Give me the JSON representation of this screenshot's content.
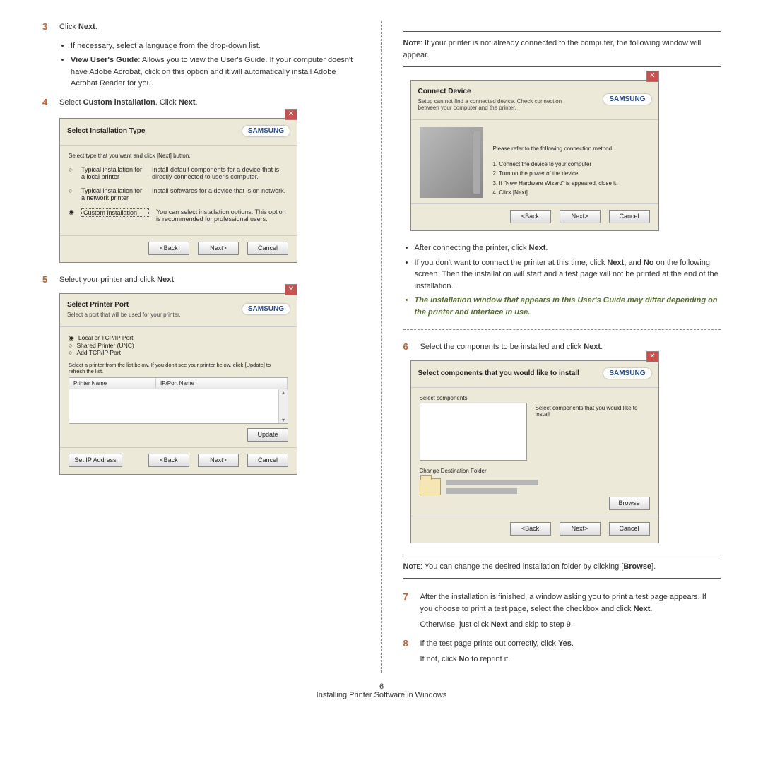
{
  "page_number": "6",
  "footer": "Installing Printer Software in Windows",
  "brand": "SAMSUNG",
  "left": {
    "step3": {
      "num": "3",
      "text_prefix": "Click ",
      "text_bold": "Next",
      "text_suffix": ".",
      "b1": "If necessary, select a language from the drop-down list.",
      "b2_bold": "View User's Guide",
      "b2_rest": ": Allows you to view the User's Guide. If your computer doesn't have Adobe Acrobat, click on this option and it will automatically install Adobe Acrobat Reader for you."
    },
    "step4": {
      "num": "4",
      "t1": "Select ",
      "t2": "Custom installation",
      "t3": ". Click ",
      "t4": "Next",
      "t5": "."
    },
    "dlg1": {
      "title": "Select Installation Type",
      "intro": "Select type that you want and click [Next] button.",
      "opt1_lbl": "Typical installation for a local printer",
      "opt1_desc": "Install default components for a device that is directly connected to user's computer.",
      "opt2_lbl": "Typical installation for a network printer",
      "opt2_desc": "Install softwares for a device that is on network.",
      "opt3_lbl": "Custom installation",
      "opt3_desc": "You can select installation options. This option is recommended for professional users.",
      "back": "<Back",
      "next": "Next>",
      "cancel": "Cancel"
    },
    "step5": {
      "num": "5",
      "t1": "Select your printer and click ",
      "t2": "Next",
      "t3": "."
    },
    "dlg2": {
      "title": "Select Printer Port",
      "sub": "Select a port that will be used for your printer.",
      "r1": "Local or TCP/IP Port",
      "r2": "Shared Printer (UNC)",
      "r3": "Add TCP/IP Port",
      "hint": "Select a printer from the list below. If you don't see your printer below, click [Update] to refresh the list.",
      "col1": "Printer Name",
      "col2": "IP/Port Name",
      "update": "Update",
      "setip": "Set IP Address",
      "back": "<Back",
      "next": "Next>",
      "cancel": "Cancel"
    }
  },
  "right": {
    "note1_lbl": "Note",
    "note1_rest": ": If your printer is not already connected to the computer, the following window will appear.",
    "dlg_conn": {
      "title": "Connect Device",
      "sub": "Setup can not find a connected device. Check connection between your computer and the printer.",
      "intro": "Please refer to the following connection method.",
      "l1": "1. Connect the device to your computer",
      "l2": "2. Turn on the power of the device",
      "l3": "3. If \"New Hardware Wizard\" is appeared, close it.",
      "l4": "4. Click [Next]",
      "back": "<Back",
      "next": "Next>",
      "cancel": "Cancel"
    },
    "bul_after1_a": "After connecting the printer, click ",
    "bul_after1_b": "Next",
    "bul_after1_c": ".",
    "bul_after2_a": "If you don't want to connect the printer at this time, click ",
    "bul_after2_b": "Next",
    "bul_after2_c": ", and ",
    "bul_after2_d": "No",
    "bul_after2_e": " on the following screen. Then the installation will start and a test page will not be printed at the end of the installation.",
    "bul_after3": "The installation window that appears in this User's Guide may differ depending on the printer and interface in use.",
    "step6": {
      "num": "6",
      "t1": "Select the components to be installed and click ",
      "t2": "Next",
      "t3": "."
    },
    "dlg_comp": {
      "title": "Select components that you would like to install",
      "sel": "Select components",
      "side": "Select components that you would like to install",
      "chg": "Change Destination Folder",
      "browse": "Browse",
      "back": "<Back",
      "next": "Next>",
      "cancel": "Cancel"
    },
    "note2_lbl": "Note",
    "note2_a": ": You can change the desired installation folder by clicking [",
    "note2_b": "Browse",
    "note2_c": "].",
    "step7": {
      "num": "7",
      "t1": "After the installation is finished, a window asking you to print a test page appears. If you choose to print a test page, select the checkbox and click ",
      "t2": "Next",
      "t3": ".",
      "t4": "Otherwise, just click ",
      "t5": "Next",
      "t6": " and skip to step 9."
    },
    "step8": {
      "num": "8",
      "t1": "If the test page prints out correctly, click ",
      "t2": "Yes",
      "t3": ".",
      "t4": "If not, click ",
      "t5": "No",
      "t6": " to reprint it."
    }
  }
}
